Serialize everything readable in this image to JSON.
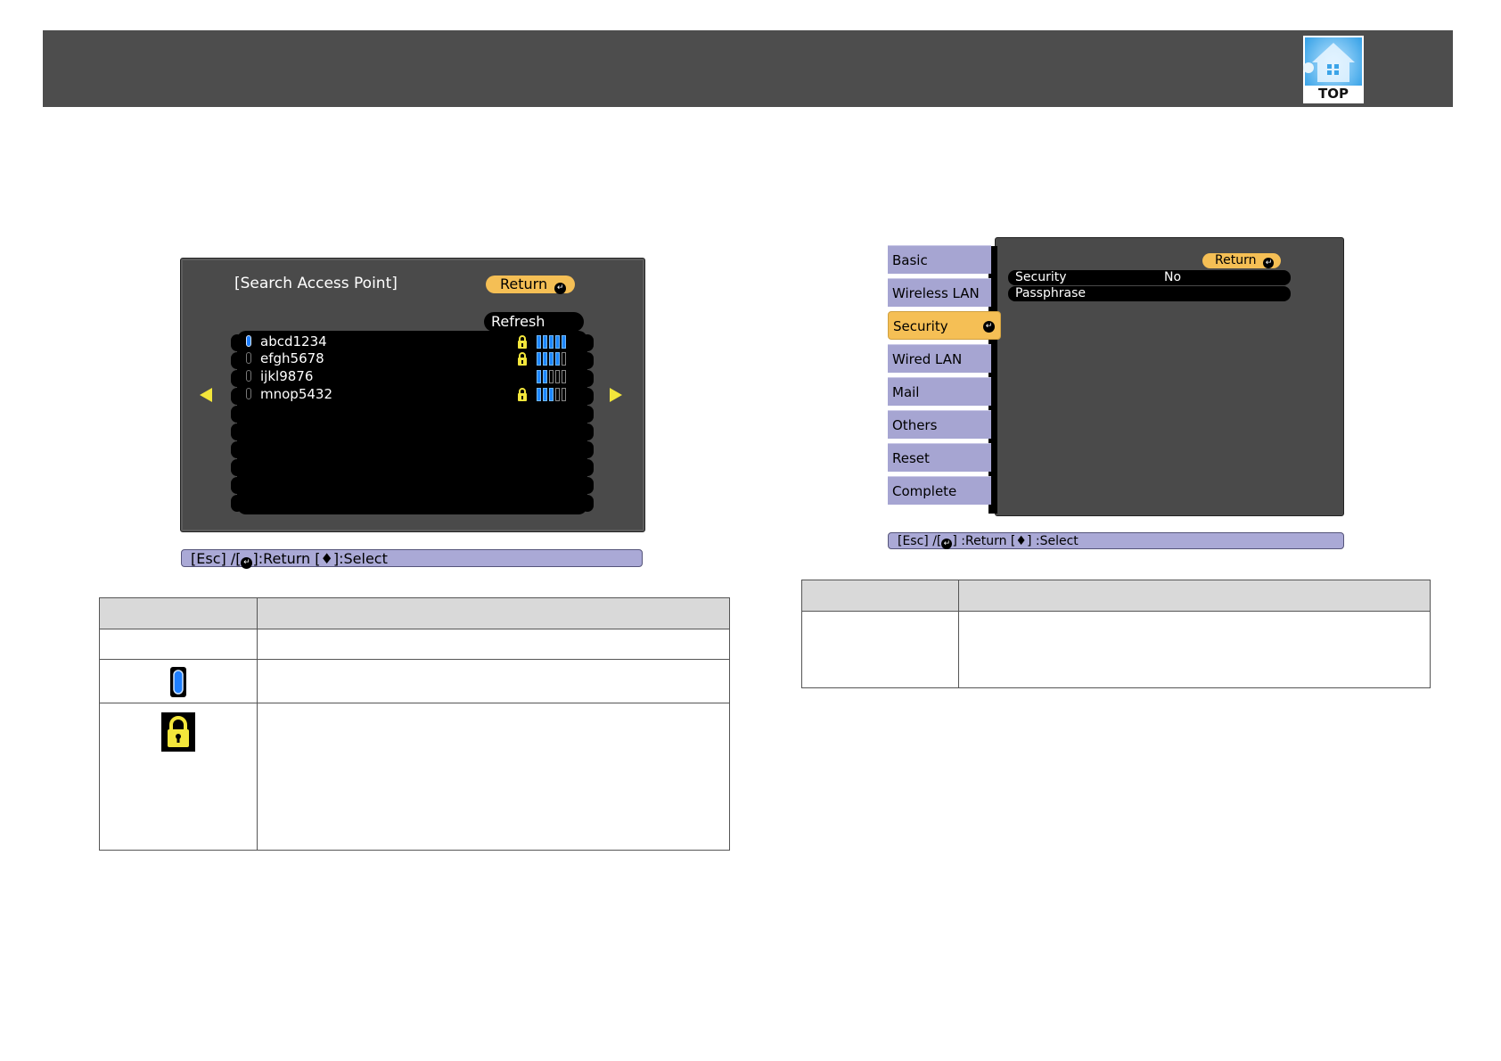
{
  "header": {
    "logo_text": "TOP"
  },
  "screen1": {
    "title": "[Search Access Point]",
    "return_label": "Return",
    "refresh_label": "Refresh",
    "access_points": [
      {
        "ssid": "abcd1234",
        "selected": true,
        "locked": true,
        "signal": 5
      },
      {
        "ssid": "efgh5678",
        "selected": false,
        "locked": true,
        "signal": 4
      },
      {
        "ssid": "ijkl9876",
        "selected": false,
        "locked": false,
        "signal": 2
      },
      {
        "ssid": "mnop5432",
        "selected": false,
        "locked": true,
        "signal": 3
      }
    ],
    "help_bar": {
      "esc": "[Esc] /[",
      "return": "]:Return  [",
      "select": "]:Select"
    }
  },
  "screen2": {
    "return_label": "Return",
    "menu": [
      "Basic",
      "Wireless LAN",
      "Security",
      "Wired LAN",
      "Mail",
      "Others",
      "Reset",
      "Complete"
    ],
    "active_menu": "Security",
    "settings": [
      {
        "label": "Security",
        "value": "No"
      },
      {
        "label": "Passphrase",
        "value": ""
      }
    ],
    "help_bar": {
      "esc": "[Esc] /[",
      "return": "] :Return  [",
      "select": "] :Select"
    }
  },
  "colors": {
    "header_bg": "#4d4d4d",
    "osd_bg": "#4a4a4a",
    "return_button": "#f5bf55",
    "help_bar": "#aaa9d6",
    "menu_item": "#a6a5d2",
    "signal_bar": "#1e88ff",
    "lock_icon": "#f3e63b"
  },
  "icons": {
    "selected_marker": "selected-marker-icon",
    "lock": "lock-icon",
    "enter": "enter-icon",
    "up_down": "up-down-arrow-icon"
  }
}
